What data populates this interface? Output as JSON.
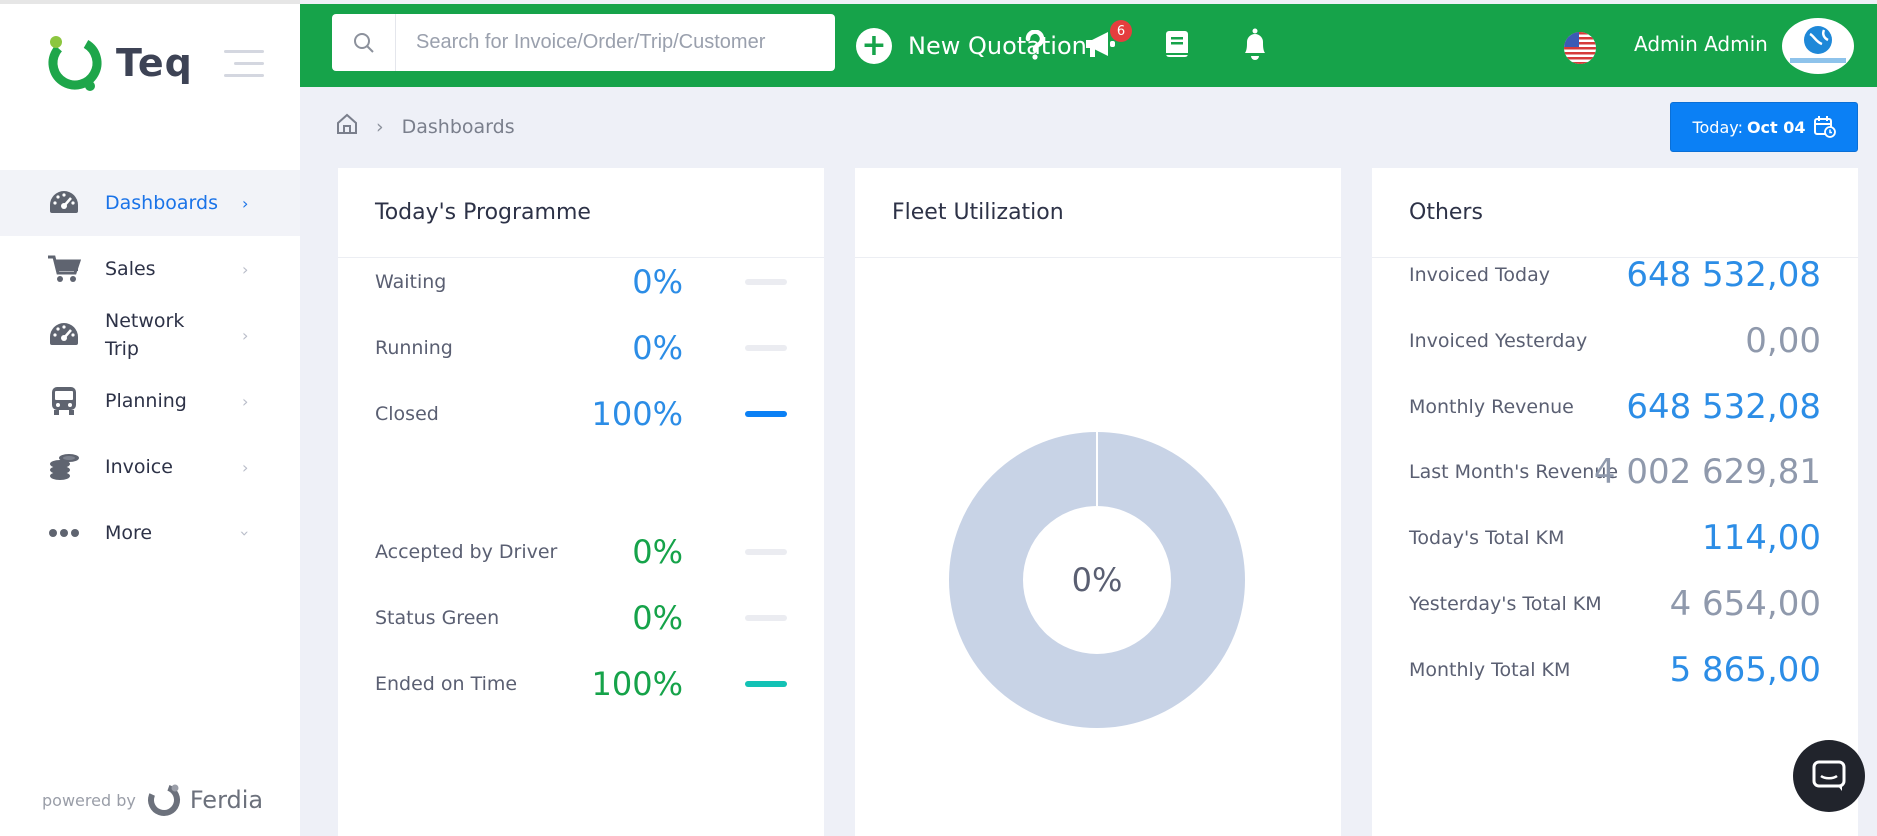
{
  "brand": {
    "name": "Teq"
  },
  "sidebar": {
    "items": [
      {
        "label": "Dashboards",
        "icon": "gauge-icon"
      },
      {
        "label": "Sales",
        "icon": "cart-icon"
      },
      {
        "label": "Network Trip",
        "icon": "gauge-icon"
      },
      {
        "label": "Planning",
        "icon": "bus-icon"
      },
      {
        "label": "Invoice",
        "icon": "coins-icon"
      },
      {
        "label": "More",
        "icon": "dots-icon"
      }
    ],
    "powered_by": "powered by",
    "powered_brand": "Ferdia"
  },
  "topbar": {
    "search_placeholder": "Search for Invoice/Order/Trip/Customer",
    "new_quotation": "New Quotation",
    "notifications_badge": "6",
    "username": "Admin Admin",
    "accent": "#16a34a"
  },
  "breadcrumb": {
    "current": "Dashboards"
  },
  "today": {
    "prefix": "Today:",
    "date": "Oct 04"
  },
  "programme": {
    "title": "Today's Programme",
    "rows": [
      {
        "label": "Waiting",
        "value": "0%",
        "fill": 0
      },
      {
        "label": "Running",
        "value": "0%",
        "fill": 0
      },
      {
        "label": "Closed",
        "value": "100%",
        "fill": 1
      },
      {
        "label": "Accepted by Driver",
        "value": "0%",
        "fill": 0
      },
      {
        "label": "Status Green",
        "value": "0%",
        "fill": 0
      },
      {
        "label": "Ended on Time",
        "value": "100%",
        "fill": 1
      }
    ]
  },
  "fleet": {
    "title": "Fleet Utilization",
    "center_label": "0%",
    "utilization": 0
  },
  "others": {
    "title": "Others",
    "rows": [
      {
        "label": "Invoiced Today",
        "value": "648 532,08"
      },
      {
        "label": "Invoiced Yesterday",
        "value": "0,00"
      },
      {
        "label": "Monthly Revenue",
        "value": "648 532,08"
      },
      {
        "label": "Last Month's Revenue",
        "value": "4 002 629,81"
      },
      {
        "label": "Today's Total KM",
        "value": "114,00"
      },
      {
        "label": "Yesterday's Total KM",
        "value": "4 654,00"
      },
      {
        "label": "Monthly Total KM",
        "value": "5 865,00"
      }
    ]
  },
  "colors": {
    "primary": "#0b80f5",
    "value_blue": "#2c8de6",
    "value_green": "#16a34a",
    "value_gray": "#8f99ac",
    "bar_blue": "#0b80f5",
    "bar_teal": "#13c2b5",
    "donut": "#c8d3e6"
  }
}
